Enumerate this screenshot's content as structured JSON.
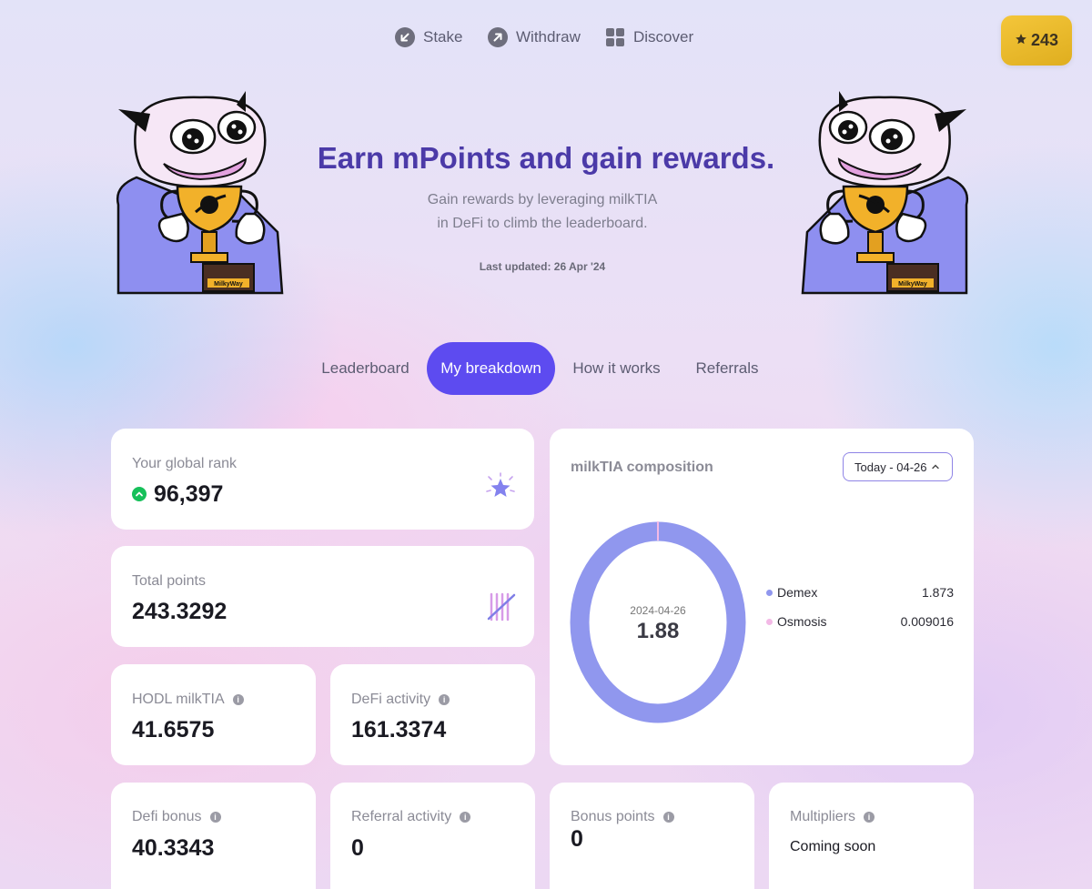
{
  "nav": {
    "items": [
      {
        "label": "Stake",
        "icon": "arrow-down-left-icon"
      },
      {
        "label": "Withdraw",
        "icon": "arrow-up-right-icon"
      },
      {
        "label": "Discover",
        "icon": "grid-icon"
      }
    ],
    "points_badge": "243"
  },
  "hero": {
    "title": "Earn mPoints and gain rewards.",
    "subtitle_line1": "Gain rewards by leveraging milkTIA",
    "subtitle_line2": "in DeFi to climb the leaderboard.",
    "last_updated": "Last updated: 26 Apr '24",
    "mascot_plaque": "MilkyWay"
  },
  "tabs": [
    "Leaderboard",
    "My breakdown",
    "How it works",
    "Referrals"
  ],
  "active_tab": "My breakdown",
  "stats": {
    "global_rank": {
      "label": "Your global rank",
      "value": "96,397"
    },
    "total_points": {
      "label": "Total points",
      "value": "243.3292"
    },
    "hodl": {
      "label": "HODL milkTIA",
      "value": "41.6575"
    },
    "defi_activity": {
      "label": "DeFi activity",
      "value": "161.3374"
    },
    "defi_bonus": {
      "label": "Defi bonus",
      "value": "40.3343"
    },
    "referral_activity": {
      "label": "Referral activity",
      "value": "0"
    },
    "bonus_points": {
      "label": "Bonus points",
      "value": "0"
    },
    "multipliers": {
      "label": "Multipliers",
      "value": "Coming soon"
    }
  },
  "composition": {
    "title": "milkTIA composition",
    "date_select": "Today - 04-26",
    "center_date": "2024-04-26",
    "center_value": "1.88",
    "legend": [
      {
        "name": "Demex",
        "value": "1.873",
        "color": "#9097ee"
      },
      {
        "name": "Osmosis",
        "value": "0.009016",
        "color": "#f3b9e6"
      }
    ]
  },
  "colors": {
    "accent": "#5d4bf0",
    "badge": "#f0c232",
    "title": "#4b3aa8",
    "rank_up": "#16c05a"
  }
}
